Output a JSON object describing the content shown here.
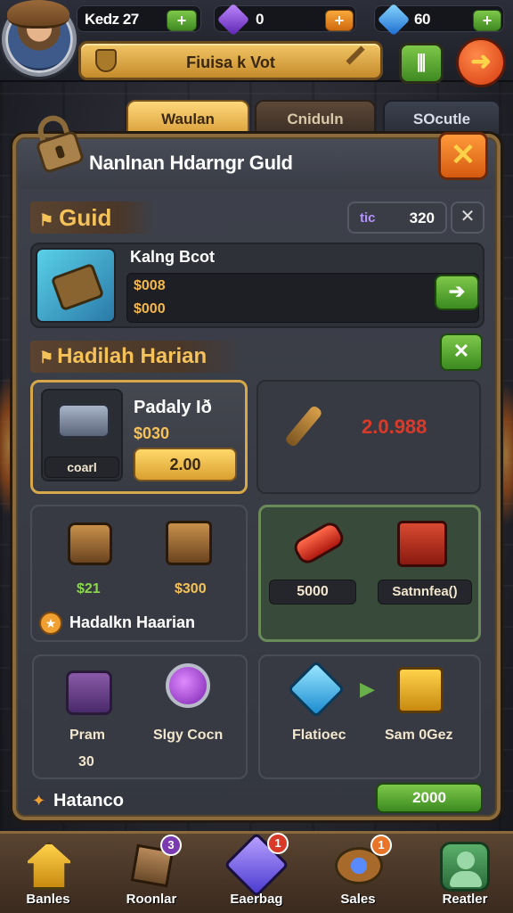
{
  "topbar": {
    "level_label": "Kedz 27",
    "green_plus": "+",
    "purple_gem_count": "0",
    "orange_plus": "+",
    "blue_gem_count": "60",
    "green_plus2": "+",
    "title_banner": "Fiuisa k Vot"
  },
  "tabs": [
    "Waulan",
    "Cniduln",
    "SOcutle"
  ],
  "panel": {
    "title": "Nanlnan Hdarngr Guld",
    "close_glyph": "✕"
  },
  "guild": {
    "label": "Guid",
    "pill_tag": "tic",
    "pill_value": "320",
    "pill_close": "✕",
    "item_title": "Kalng Bcot",
    "item_line1": "$008",
    "item_line2": "$000"
  },
  "daily": {
    "label": "Hadilah  Harian",
    "close_glyph": "✕",
    "card1_title": "Padaly Ið",
    "card1_price": "$030",
    "card1_tag": "coarl",
    "card1_button": "2.00",
    "card2_value": "2.0.988",
    "card3_val1": "$21",
    "card3_val2": "$300",
    "card3_footer": "Hadalkn Haarian",
    "card4_val1": "5000",
    "card4_val2": "Satnnfea()",
    "card5_label1": "Pram",
    "card5_label2": "Slgy Cocn",
    "card5_value": "30",
    "card6_label1": "Flatioec",
    "card6_label2": "Sam 0Gez"
  },
  "footer": {
    "label": "Hatanco",
    "button_value": "2000"
  },
  "nav": [
    {
      "label": "Banles",
      "badge": ""
    },
    {
      "label": "Roonlar",
      "badge": "3"
    },
    {
      "label": "Eaerbag",
      "badge": "1"
    },
    {
      "label": "Sales",
      "badge": "1"
    },
    {
      "label": "Reatler",
      "badge": ""
    }
  ],
  "colors": {
    "accent_gold": "#d9a13c",
    "accent_orange": "#d55a10",
    "accent_green": "#3f8a22",
    "value_red": "#d93a2a"
  }
}
